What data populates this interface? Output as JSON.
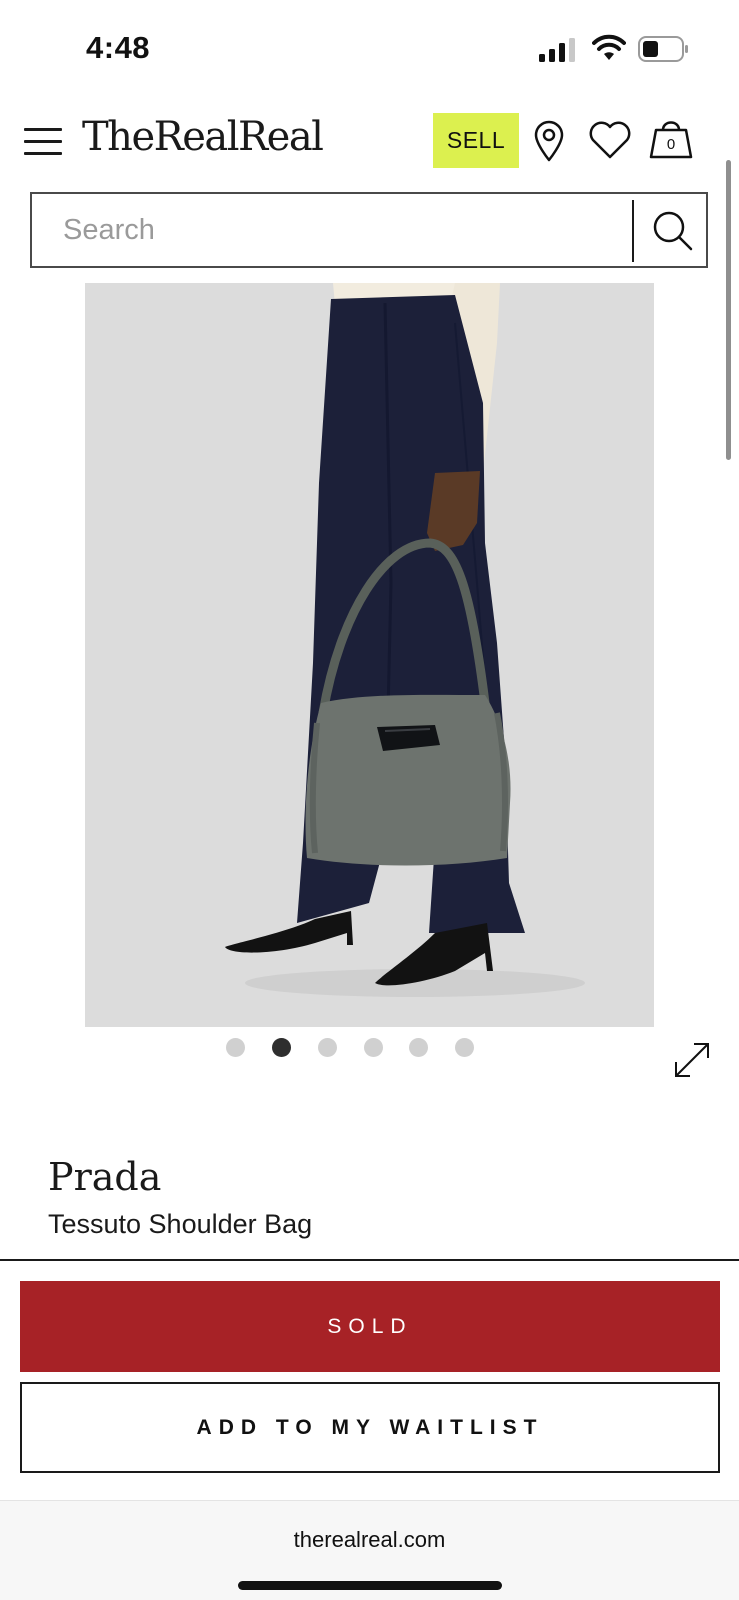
{
  "status_bar": {
    "time": "4:48",
    "icons": [
      "cellular-signal-icon",
      "wifi-icon",
      "battery-icon"
    ]
  },
  "header": {
    "brand_logo": "TheRealReal",
    "sell_label": "SELL",
    "bag_count": "0",
    "icons": [
      "menu-icon",
      "location-pin-icon",
      "heart-icon",
      "shopping-bag-icon"
    ],
    "sell_color": "#dcf04f"
  },
  "search": {
    "placeholder": "Search",
    "value": "",
    "icon": "search-icon"
  },
  "gallery": {
    "total_images": 6,
    "active_index": 1,
    "expand_icon": "expand-arrows-icon"
  },
  "product": {
    "brand": "Prada",
    "name": "Tessuto Shoulder Bag"
  },
  "actions": {
    "sold_label": "SOLD",
    "waitlist_label": "ADD TO MY WAITLIST",
    "sold_color": "#a72226"
  },
  "browser": {
    "url": "therealreal.com"
  }
}
